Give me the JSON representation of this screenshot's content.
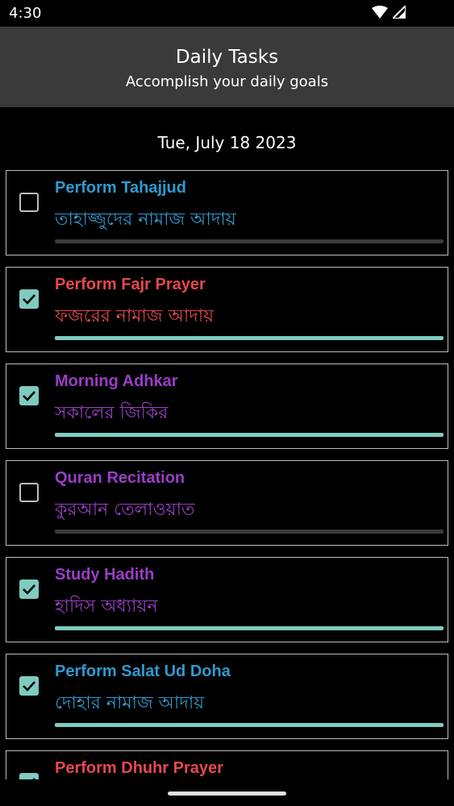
{
  "status_bar": {
    "time": "4:30"
  },
  "app_bar": {
    "title": "Daily Tasks",
    "subtitle": "Accomplish your daily goals"
  },
  "date": "Tue, July 18 2023",
  "colors": {
    "blue": "#2f9ad0",
    "red": "#e5484d",
    "purple": "#9a3ec6",
    "accent": "#7fcbbf"
  },
  "tasks": [
    {
      "title": "Perform Tahajjud",
      "subtitle": "তাহাজ্জুদের নামাজ আদায়",
      "checked": false,
      "progress": 0,
      "color": "#2f9ad0"
    },
    {
      "title": "Perform Fajr Prayer",
      "subtitle": "ফজরের নামাজ আদায়",
      "checked": true,
      "progress": 1,
      "color": "#e5484d"
    },
    {
      "title": "Morning Adhkar",
      "subtitle": "সকালের জিকির",
      "checked": true,
      "progress": 1,
      "color": "#9a3ec6"
    },
    {
      "title": "Quran Recitation",
      "subtitle": "কুরআন তেলাওয়াত",
      "checked": false,
      "progress": 0,
      "color": "#9a3ec6"
    },
    {
      "title": "Study Hadith",
      "subtitle": "হাদিস অধ্যায়ন",
      "checked": true,
      "progress": 1,
      "color": "#9a3ec6"
    },
    {
      "title": "Perform Salat Ud Doha",
      "subtitle": "দোহার নামাজ আদায়",
      "checked": true,
      "progress": 1,
      "color": "#2f9ad0"
    },
    {
      "title": "Perform Dhuhr Prayer",
      "subtitle": "",
      "checked": true,
      "progress": 1,
      "color": "#e5484d"
    }
  ]
}
